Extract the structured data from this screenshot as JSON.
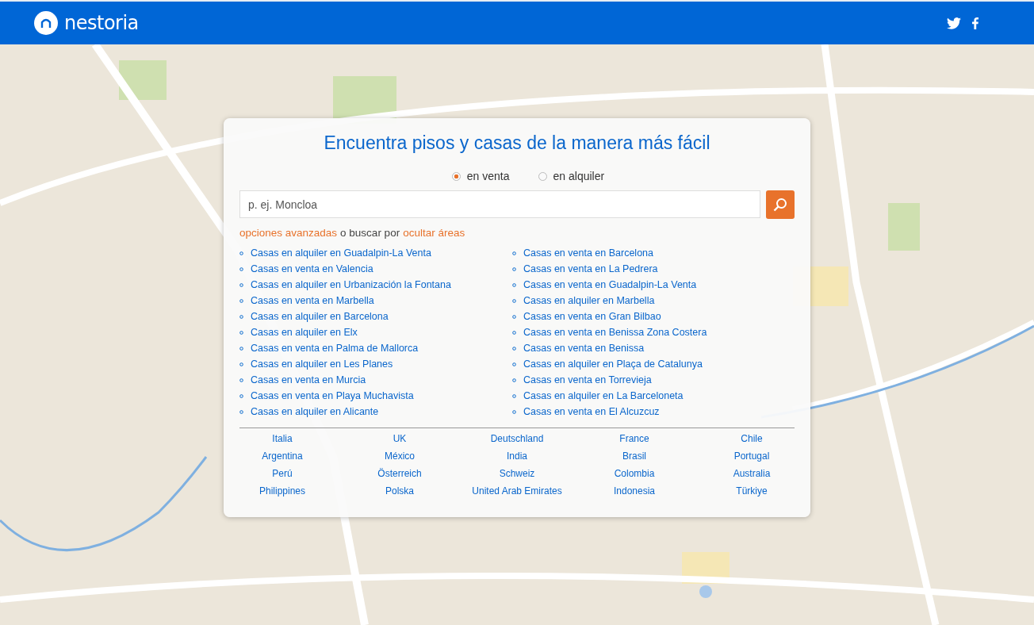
{
  "header": {
    "logo": "nestoria"
  },
  "search": {
    "title": "Encuentra pisos y casas de la manera más fácil",
    "options": [
      {
        "label": "en venta",
        "selected": true
      },
      {
        "label": "en alquiler",
        "selected": false
      }
    ],
    "placeholder": "p. ej. Moncloa",
    "advanced_link": "opciones avanzadas",
    "connector": "o buscar por",
    "areas_link": "ocultar áreas"
  },
  "popular_searches": [
    [
      "Casas en alquiler en Guadalpin-La Venta",
      "Casas en venta en Valencia",
      "Casas en alquiler en Urbanización la Fontana",
      "Casas en venta en Marbella",
      "Casas en alquiler en Barcelona",
      "Casas en alquiler en Elx",
      "Casas en venta en Palma de Mallorca",
      "Casas en alquiler en Les Planes",
      "Casas en venta en Murcia",
      "Casas en venta en Playa Muchavista",
      "Casas en alquiler en Alicante"
    ],
    [
      "Casas en venta en Barcelona",
      "Casas en venta en La Pedrera",
      "Casas en venta en Guadalpin-La Venta",
      "Casas en alquiler en Marbella",
      "Casas en venta en Gran Bilbao",
      "Casas en venta en Benissa Zona Costera",
      "Casas en venta en Benissa",
      "Casas en alquiler en Plaça de Catalunya",
      "Casas en venta en Torrevieja",
      "Casas en alquiler en La Barceloneta",
      "Casas en venta en El Alcuzcuz"
    ]
  ],
  "countries": [
    "Italia",
    "UK",
    "Deutschland",
    "France",
    "Chile",
    "Argentina",
    "México",
    "India",
    "Brasil",
    "Portugal",
    "Perú",
    "Österreich",
    "Schweiz",
    "Colombia",
    "Australia",
    "Philippines",
    "Polska",
    "United Arab Emirates",
    "Indonesia",
    "Türkiye"
  ]
}
